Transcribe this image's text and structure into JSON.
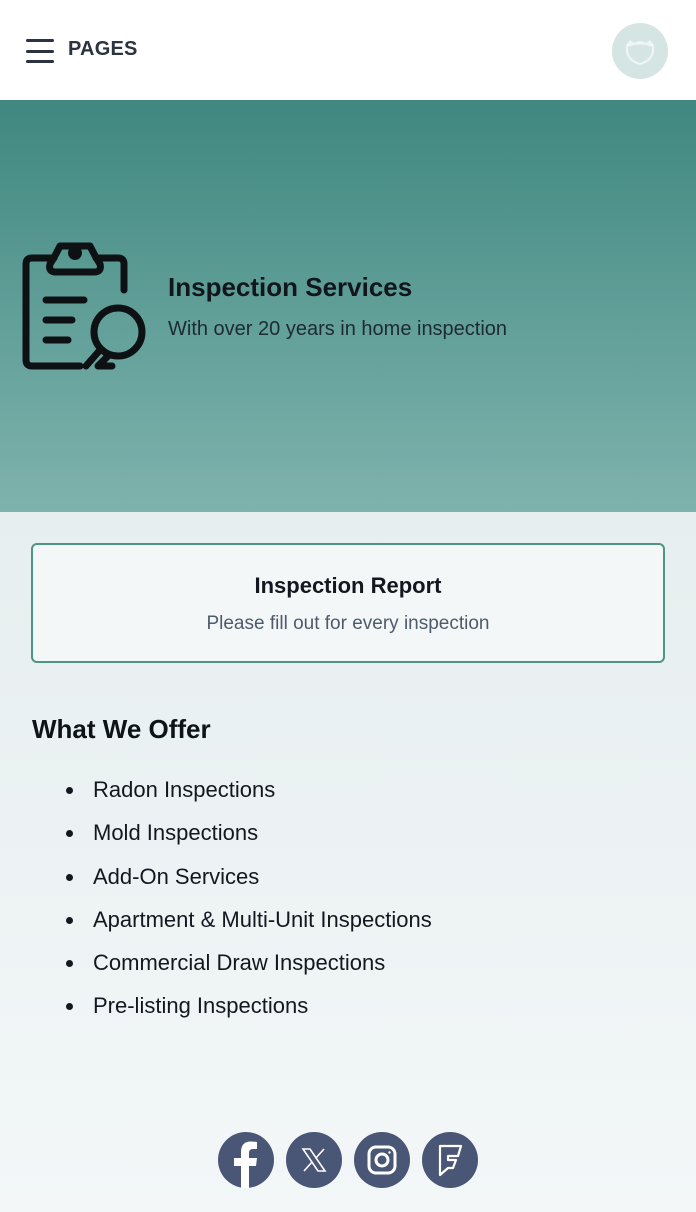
{
  "header": {
    "menu_label": "PAGES",
    "menu_icon": "hamburger-icon",
    "logo_icon": "cat-logo-icon"
  },
  "hero": {
    "icon": "clipboard-search-icon",
    "title": "Inspection Services",
    "subtitle": "With over 20 years in home inspection"
  },
  "report_card": {
    "title": "Inspection Report",
    "subtitle": "Please fill out for every inspection"
  },
  "offer": {
    "title": "What We Offer",
    "items": [
      "Radon Inspections",
      "Mold Inspections",
      "Add-On Services",
      "Apartment & Multi-Unit Inspections",
      "Commercial Draw Inspections",
      "Pre-listing Inspections"
    ]
  },
  "social": [
    {
      "name": "Facebook",
      "icon": "facebook-icon"
    },
    {
      "name": "X",
      "icon": "x-icon"
    },
    {
      "name": "Instagram",
      "icon": "instagram-icon"
    },
    {
      "name": "Foursquare",
      "icon": "foursquare-icon"
    }
  ],
  "colors": {
    "hero_top": "#3f877f",
    "hero_bottom": "#7fb2ad",
    "card_border": "#4e9485",
    "social_bg": "#4a5675"
  }
}
